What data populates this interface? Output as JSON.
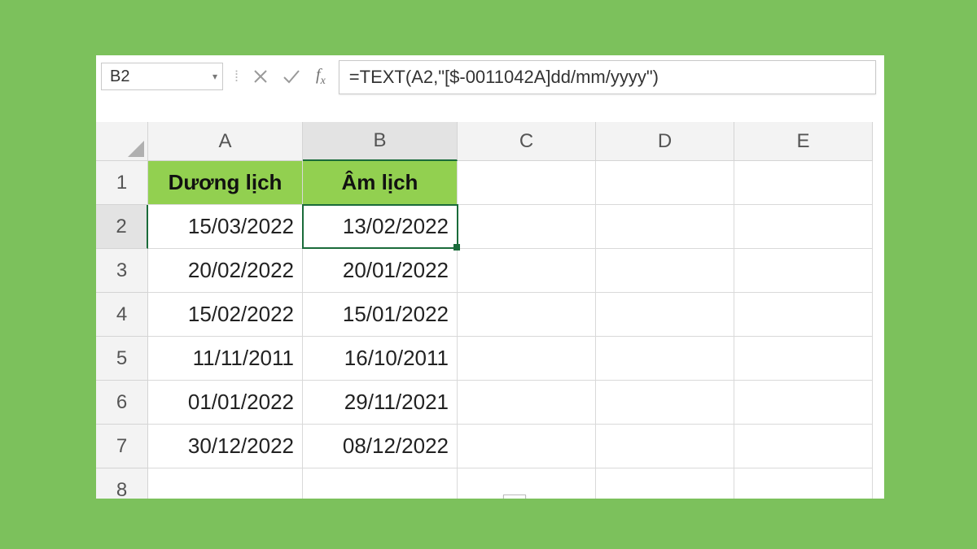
{
  "namebox": {
    "value": "B2"
  },
  "formula_bar": {
    "value": "=TEXT(A2,\"[$-0011042A]dd/mm/yyyy\")"
  },
  "columns": [
    "A",
    "B",
    "C",
    "D",
    "E"
  ],
  "selected_column_index": 1,
  "row_numbers": [
    1,
    2,
    3,
    4,
    5,
    6,
    7,
    8
  ],
  "selected_row_index": 1,
  "headers": {
    "A": "Dương lịch",
    "B": "Âm lịch"
  },
  "rows": [
    {
      "A": "15/03/2022",
      "B": "13/02/2022"
    },
    {
      "A": "20/02/2022",
      "B": "20/01/2022"
    },
    {
      "A": "15/02/2022",
      "B": "15/01/2022"
    },
    {
      "A": "11/11/2011",
      "B": "16/10/2011"
    },
    {
      "A": "01/01/2022",
      "B": "29/11/2021"
    },
    {
      "A": "30/12/2022",
      "B": "08/12/2022"
    }
  ],
  "selected_cell": "B2",
  "colors": {
    "accent": "#92d050",
    "selection": "#1a6b3a"
  }
}
